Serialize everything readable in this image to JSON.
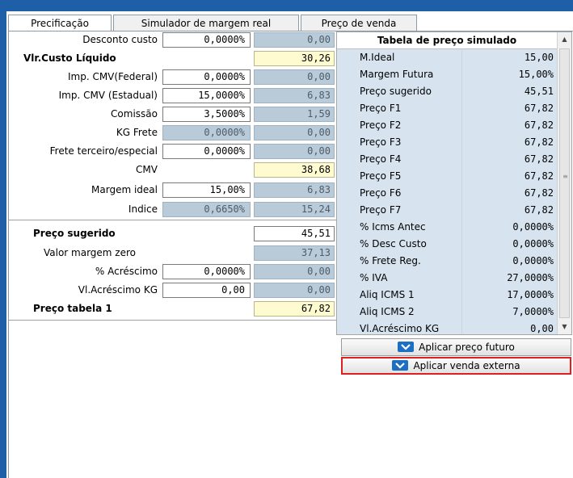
{
  "tabs": [
    "Precificação",
    "Simulador de margem real",
    "Preço de venda"
  ],
  "form": {
    "desconto_custo": {
      "label": "Desconto custo",
      "input": "0,0000%",
      "value": "0,00"
    },
    "vlr_custo_liquido": {
      "label": "Vlr.Custo Líquido",
      "value": "30,26"
    },
    "imp_cmv_federal": {
      "label": "Imp. CMV(Federal)",
      "input": "0,0000%",
      "value": "0,00"
    },
    "imp_cmv_estadual": {
      "label": "Imp. CMV (Estadual)",
      "input": "15,0000%",
      "value": "6,83"
    },
    "comissao": {
      "label": "Comissão",
      "input": "3,5000%",
      "value": "1,59"
    },
    "kg_frete": {
      "label": "KG Frete",
      "input": "0,0000%",
      "value": "0,00"
    },
    "frete_terceiro": {
      "label": "Frete terceiro/especial",
      "input": "0,0000%",
      "value": "0,00"
    },
    "cmv": {
      "label": "CMV",
      "value": "38,68"
    },
    "margem_ideal": {
      "label": "Margem ideal",
      "input": "15,00%",
      "value": "6,83"
    },
    "indice": {
      "label": "Indice",
      "input": "0,6650%",
      "value": "15,24"
    },
    "preco_sugerido": {
      "label": "Preço sugerido",
      "value": "45,51"
    },
    "valor_margem_zero": {
      "label": "Valor margem zero",
      "value": "37,13"
    },
    "pct_acrescimo": {
      "label": "% Acréscimo",
      "input": "0,0000%",
      "value": "0,00"
    },
    "vl_acrescimo_kg": {
      "label": "Vl.Acréscimo KG",
      "input": "0,00",
      "value": "0,00"
    },
    "preco_tabela_1": {
      "label": "Preço tabela 1",
      "value": "67,82"
    }
  },
  "grid": {
    "title": "Tabela de preço simulado",
    "rows": [
      {
        "name": "M.Ideal",
        "value": "15,00"
      },
      {
        "name": "Margem Futura",
        "value": "15,00%"
      },
      {
        "name": "Preço sugerido",
        "value": "45,51"
      },
      {
        "name": "Preço F1",
        "value": "67,82"
      },
      {
        "name": "Preço F2",
        "value": "67,82"
      },
      {
        "name": "Preço F3",
        "value": "67,82"
      },
      {
        "name": "Preço F4",
        "value": "67,82"
      },
      {
        "name": "Preço F5",
        "value": "67,82"
      },
      {
        "name": "Preço F6",
        "value": "67,82"
      },
      {
        "name": "Preço F7",
        "value": "67,82"
      },
      {
        "name": "% Icms Antec",
        "value": "0,0000%"
      },
      {
        "name": "% Desc Custo",
        "value": "0,0000%"
      },
      {
        "name": "% Frete Reg.",
        "value": "0,0000%"
      },
      {
        "name": "% IVA",
        "value": "27,0000%"
      },
      {
        "name": "Aliq ICMS 1",
        "value": "17,0000%"
      },
      {
        "name": "Aliq ICMS 2",
        "value": "7,0000%"
      },
      {
        "name": "Vl.Acréscimo KG",
        "value": "0,00"
      }
    ]
  },
  "buttons": {
    "aplicar_preco_futuro": "Aplicar preço futuro",
    "aplicar_venda_externa": "Aplicar venda externa"
  },
  "colors": {
    "frame": "#1f5fa8",
    "highlight": "#e02020",
    "readonly": "#b9cbd9",
    "calc": "#fffbd1",
    "grid": "#d7e4f0"
  }
}
